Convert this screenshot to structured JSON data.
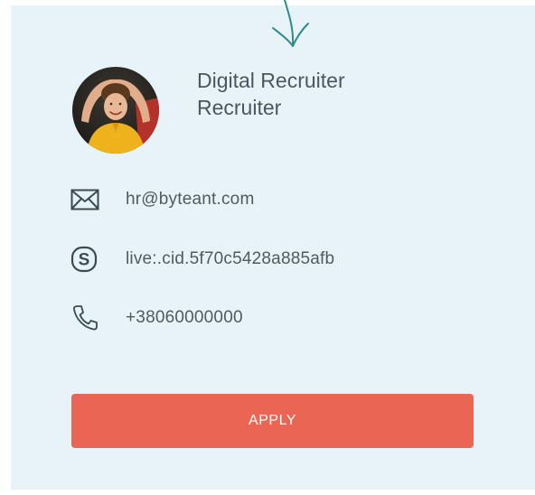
{
  "profile": {
    "title": "Digital Recruiter",
    "role": "Recruiter"
  },
  "contacts": {
    "email": "hr@byteant.com",
    "skype": "live:.cid.5f70c5428a885afb",
    "phone": "+38060000000"
  },
  "actions": {
    "apply_label": "APPLY"
  },
  "icons": {
    "arrow": "hand-drawn-arrow-icon",
    "email": "envelope-icon",
    "skype": "skype-icon",
    "phone": "phone-icon"
  },
  "colors": {
    "card_background": "#e7f3f7",
    "accent": "#eb6652",
    "arrow": "#2f8a8a",
    "text": "#4f5a63"
  }
}
